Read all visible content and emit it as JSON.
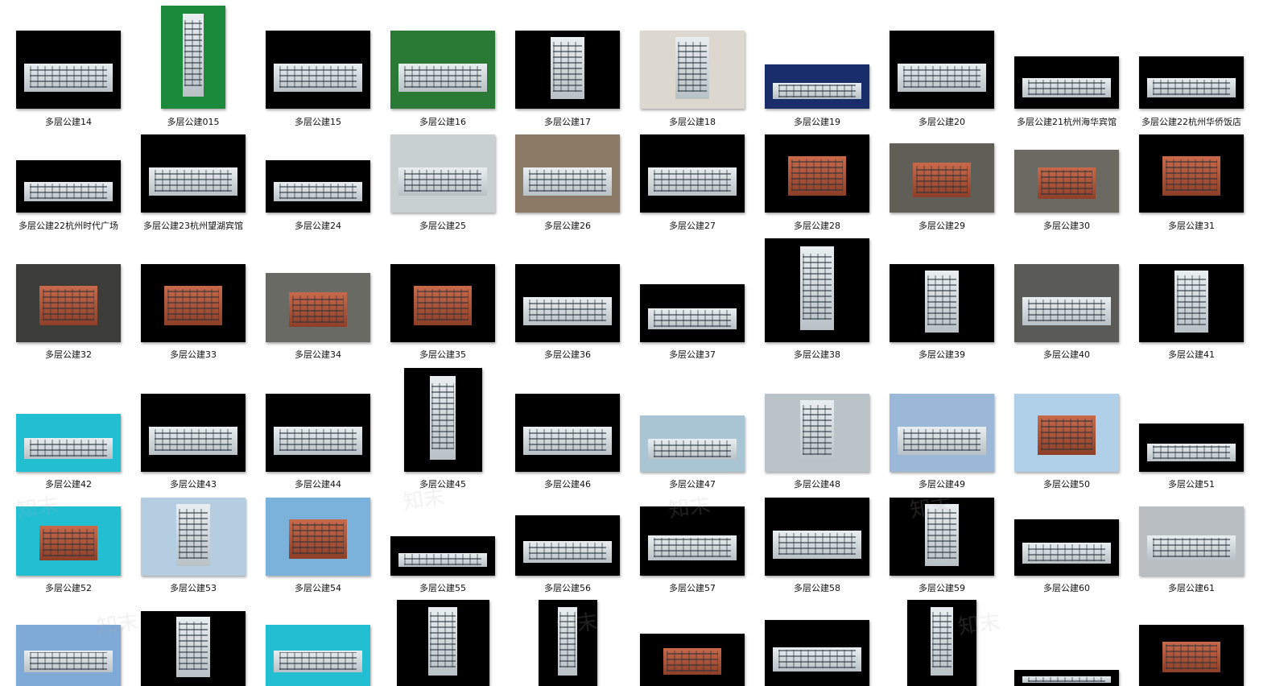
{
  "watermark_text": "知末",
  "rows": [
    [
      {
        "label": "多层公建14",
        "w": 130,
        "h": 97,
        "bg": "#000000",
        "style": "wide"
      },
      {
        "label": "多层公建015",
        "w": 80,
        "h": 128,
        "bg": "#1b8a3a",
        "style": "tall"
      },
      {
        "label": "多层公建15",
        "w": 130,
        "h": 97,
        "bg": "#000000",
        "style": "wide"
      },
      {
        "label": "多层公建16",
        "w": 130,
        "h": 97,
        "bg": "#2a7a35",
        "style": "wide"
      },
      {
        "label": "多层公建17",
        "w": 130,
        "h": 97,
        "bg": "#000000",
        "style": "tall"
      },
      {
        "label": "多层公建18",
        "w": 130,
        "h": 97,
        "bg": "#ddd8cf",
        "style": "tall"
      },
      {
        "label": "多层公建19",
        "w": 130,
        "h": 55,
        "bg": "#1a2d6b",
        "style": "wide"
      },
      {
        "label": "多层公建20",
        "w": 130,
        "h": 97,
        "bg": "#000000",
        "style": "wide"
      },
      {
        "label": "多层公建21杭州海华宾馆",
        "w": 130,
        "h": 65,
        "bg": "#000000",
        "style": "wide"
      },
      {
        "label": "多层公建22杭州华侨饭店",
        "w": 130,
        "h": 65,
        "bg": "#000000",
        "style": "wide"
      }
    ],
    [
      {
        "label": "多层公建22杭州时代广场",
        "w": 130,
        "h": 65,
        "bg": "#000000",
        "style": "wide"
      },
      {
        "label": "多层公建23杭州望湖宾馆",
        "w": 130,
        "h": 97,
        "bg": "#000000",
        "style": "wide"
      },
      {
        "label": "多层公建24",
        "w": 130,
        "h": 65,
        "bg": "#000000",
        "style": "wide"
      },
      {
        "label": "多层公建25",
        "w": 130,
        "h": 97,
        "bg": "#c8d0d2",
        "style": "wide"
      },
      {
        "label": "多层公建26",
        "w": 130,
        "h": 97,
        "bg": "#8a7a66",
        "style": "wide"
      },
      {
        "label": "多层公建27",
        "w": 130,
        "h": 97,
        "bg": "#000000",
        "style": "wide"
      },
      {
        "label": "多层公建28",
        "w": 130,
        "h": 97,
        "bg": "#000000",
        "style": "brick"
      },
      {
        "label": "多层公建29",
        "w": 130,
        "h": 86,
        "bg": "#5f5f58",
        "style": "brick"
      },
      {
        "label": "多层公建30",
        "w": 130,
        "h": 78,
        "bg": "#6a6a62",
        "style": "brick"
      },
      {
        "label": "多层公建31",
        "w": 130,
        "h": 97,
        "bg": "#000000",
        "style": "brick"
      }
    ],
    [
      {
        "label": "多层公建32",
        "w": 130,
        "h": 97,
        "bg": "#3c3c38",
        "style": "brick"
      },
      {
        "label": "多层公建33",
        "w": 130,
        "h": 97,
        "bg": "#000000",
        "style": "brick"
      },
      {
        "label": "多层公建34",
        "w": 130,
        "h": 86,
        "bg": "#6a6a64",
        "style": "brick"
      },
      {
        "label": "多层公建35",
        "w": 130,
        "h": 97,
        "bg": "#000000",
        "style": "brick"
      },
      {
        "label": "多层公建36",
        "w": 130,
        "h": 97,
        "bg": "#000000",
        "style": "wide"
      },
      {
        "label": "多层公建37",
        "w": 130,
        "h": 72,
        "bg": "#000000",
        "style": "wide"
      },
      {
        "label": "多层公建38",
        "w": 130,
        "h": 129,
        "bg": "#000000",
        "style": "tall"
      },
      {
        "label": "多层公建39",
        "w": 130,
        "h": 97,
        "bg": "#000000",
        "style": "tall"
      },
      {
        "label": "多层公建40",
        "w": 130,
        "h": 97,
        "bg": "#5a5a56",
        "style": "wide"
      },
      {
        "label": "多层公建41",
        "w": 130,
        "h": 97,
        "bg": "#000000",
        "style": "tall"
      }
    ],
    [
      {
        "label": "多层公建42",
        "w": 130,
        "h": 72,
        "bg": "#22bfd2",
        "style": "wide"
      },
      {
        "label": "多层公建43",
        "w": 130,
        "h": 97,
        "bg": "#000000",
        "style": "wide"
      },
      {
        "label": "多层公建44",
        "w": 130,
        "h": 97,
        "bg": "#000000",
        "style": "wide"
      },
      {
        "label": "多层公建45",
        "w": 97,
        "h": 129,
        "bg": "#000000",
        "style": "tall"
      },
      {
        "label": "多层公建46",
        "w": 130,
        "h": 97,
        "bg": "#000000",
        "style": "wide"
      },
      {
        "label": "多层公建47",
        "w": 130,
        "h": 70,
        "bg": "#a9c4d2",
        "style": "wide"
      },
      {
        "label": "多层公建48",
        "w": 130,
        "h": 97,
        "bg": "#b9c3c8",
        "style": "tall"
      },
      {
        "label": "多层公建49",
        "w": 130,
        "h": 97,
        "bg": "#9cb8d8",
        "style": "wide"
      },
      {
        "label": "多层公建50",
        "w": 130,
        "h": 97,
        "bg": "#b0cfe8",
        "style": "brick"
      },
      {
        "label": "多层公建51",
        "w": 130,
        "h": 60,
        "bg": "#000000",
        "style": "wide"
      }
    ],
    [
      {
        "label": "多层公建52",
        "w": 130,
        "h": 86,
        "bg": "#22bfd2",
        "style": "brick"
      },
      {
        "label": "多层公建53",
        "w": 130,
        "h": 97,
        "bg": "#b4cde0",
        "style": "tall"
      },
      {
        "label": "多层公建54",
        "w": 130,
        "h": 97,
        "bg": "#7ab2dc",
        "style": "brick"
      },
      {
        "label": "多层公建55",
        "w": 130,
        "h": 49,
        "bg": "#000000",
        "style": "wide"
      },
      {
        "label": "多层公建56",
        "w": 130,
        "h": 75,
        "bg": "#000000",
        "style": "wide"
      },
      {
        "label": "多层公建57",
        "w": 130,
        "h": 86,
        "bg": "#000000",
        "style": "wide"
      },
      {
        "label": "多层公建58",
        "w": 130,
        "h": 97,
        "bg": "#000000",
        "style": "wide"
      },
      {
        "label": "多层公建59",
        "w": 130,
        "h": 97,
        "bg": "#000000",
        "style": "tall"
      },
      {
        "label": "多层公建60",
        "w": 130,
        "h": 70,
        "bg": "#000000",
        "style": "wide"
      },
      {
        "label": "多层公建61",
        "w": 130,
        "h": 86,
        "bg": "#b9bec2",
        "style": "wide"
      }
    ],
    [
      {
        "label": "",
        "w": 130,
        "h": 76,
        "bg": "#7fa9d6",
        "style": "wide"
      },
      {
        "label": "",
        "w": 130,
        "h": 93,
        "bg": "#000000",
        "style": "tall"
      },
      {
        "label": "",
        "w": 130,
        "h": 76,
        "bg": "#22bfd2",
        "style": "wide"
      },
      {
        "label": "",
        "w": 115,
        "h": 107,
        "bg": "#000000",
        "style": "tall"
      },
      {
        "label": "",
        "w": 73,
        "h": 107,
        "bg": "#000000",
        "style": "tall"
      },
      {
        "label": "",
        "w": 130,
        "h": 65,
        "bg": "#000000",
        "style": "brick"
      },
      {
        "label": "",
        "w": 130,
        "h": 82,
        "bg": "#000000",
        "style": "wide"
      },
      {
        "label": "",
        "w": 86,
        "h": 107,
        "bg": "#000000",
        "style": "tall"
      },
      {
        "label": "",
        "w": 130,
        "h": 20,
        "bg": "#000000",
        "style": "wide"
      },
      {
        "label": "",
        "w": 130,
        "h": 76,
        "bg": "#000000",
        "style": "brick"
      }
    ]
  ]
}
